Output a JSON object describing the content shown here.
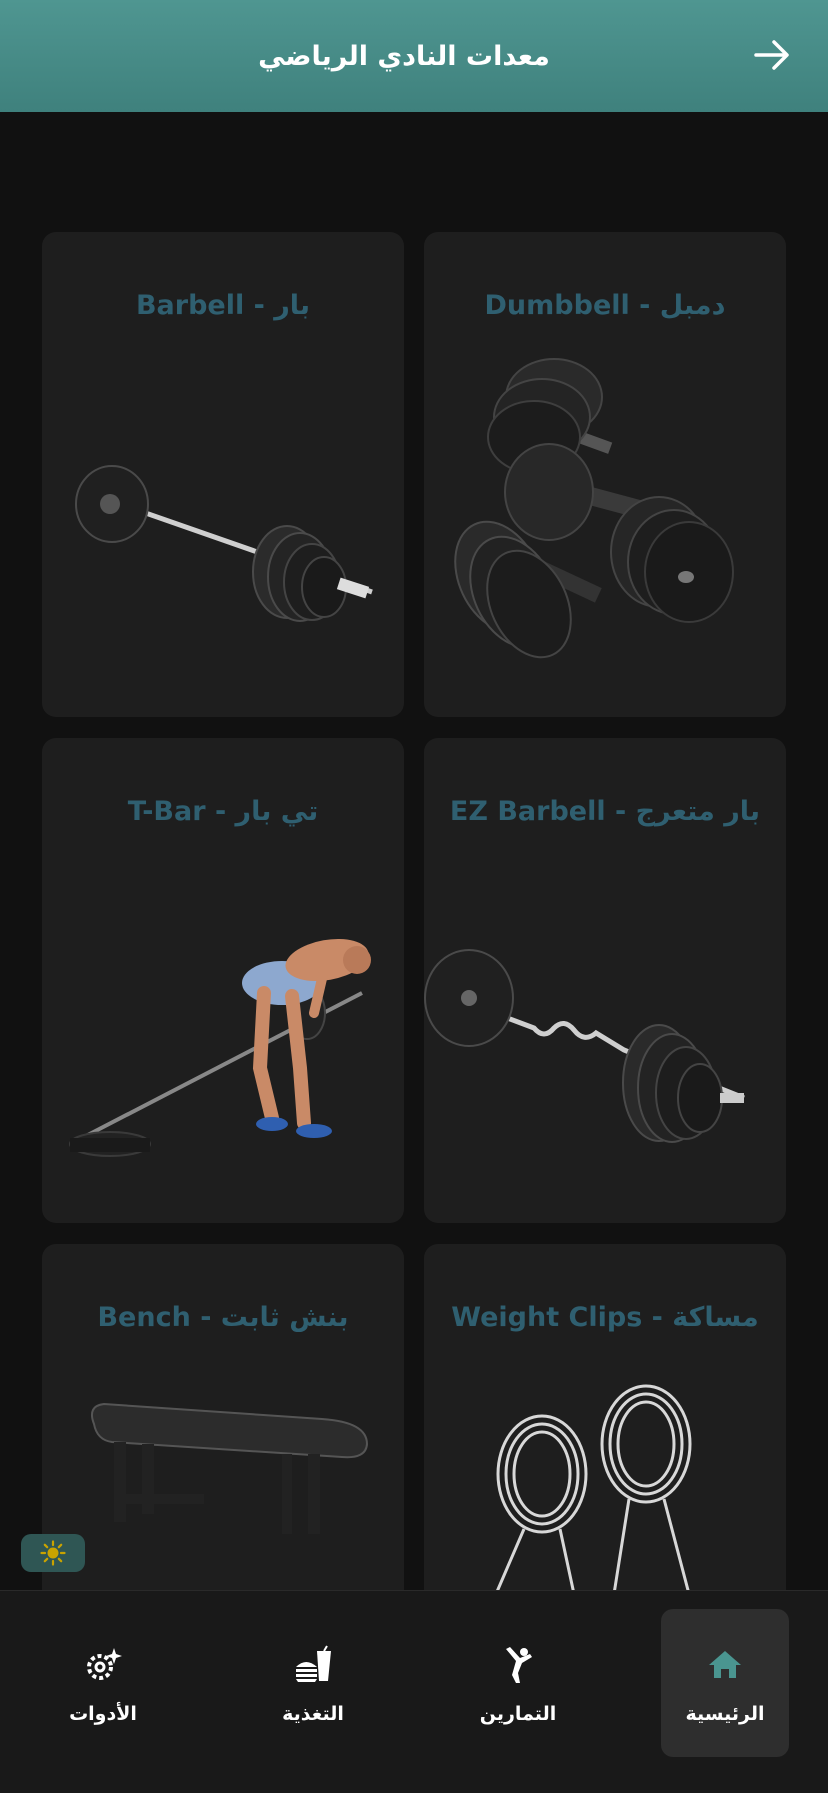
{
  "header": {
    "title": "معدات النادي الرياضي",
    "back_icon": "arrow-right-icon"
  },
  "cards": [
    {
      "title": "دمبل - Dumbbell",
      "image": "dumbbell-image"
    },
    {
      "title": "بار - Barbell",
      "image": "barbell-image"
    },
    {
      "title": "بار متعرج - EZ Barbell",
      "image": "ez-barbell-image"
    },
    {
      "title": "تي بار - T-Bar",
      "image": "t-bar-image"
    },
    {
      "title": "مساكة - Weight Clips",
      "image": "weight-clips-image"
    },
    {
      "title": "بنش ثابت - Bench",
      "image": "bench-image"
    }
  ],
  "theme_toggle": {
    "icon": "sun-icon"
  },
  "nav": [
    {
      "label": "الرئيسية",
      "icon": "home-icon",
      "active": true
    },
    {
      "label": "التمارين",
      "icon": "martial-arts-icon",
      "active": false
    },
    {
      "label": "التغذية",
      "icon": "burger-drink-icon",
      "active": false
    },
    {
      "label": "الأدوات",
      "icon": "gear-sparkle-icon",
      "active": false
    }
  ],
  "colors": {
    "header": "#4a8f8a",
    "card_title": "#2f5f70",
    "background": "#111111",
    "card": "#1e1e1e"
  }
}
